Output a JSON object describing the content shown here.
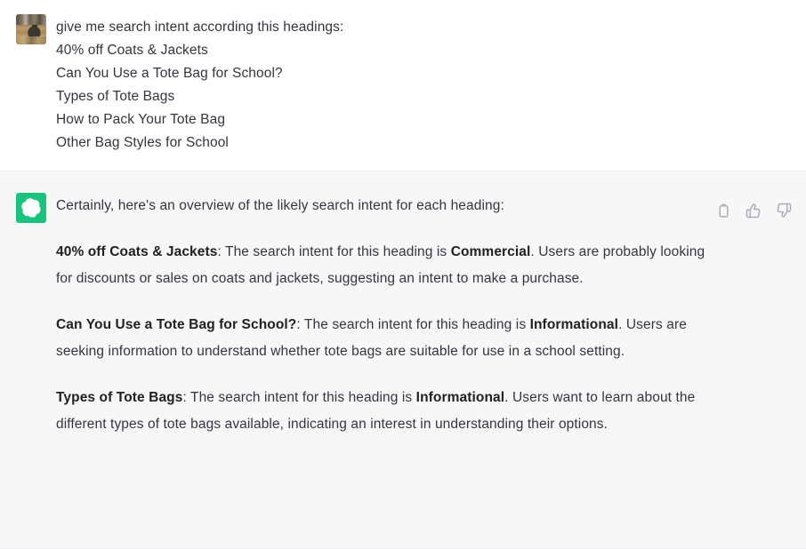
{
  "theme": {
    "user_bg": "#ffffff",
    "assistant_bg": "#f7f7f8",
    "text_color": "#343541",
    "divider": "#ececf1",
    "brand_green": "#19c37d",
    "icon_color": "#acacbe"
  },
  "user_message": {
    "avatar_alt": "user-profile-photo",
    "lines": [
      "give me search intent according this headings:",
      "40% off Coats & Jackets",
      "Can You Use a Tote Bag for School?",
      "Types of Tote Bags",
      "How to Pack Your Tote Bag",
      "Other Bag Styles for School"
    ]
  },
  "assistant_message": {
    "avatar_alt": "openai-logo",
    "intro": "Certainly, here's an overview of the likely search intent for each heading:",
    "paragraphs": [
      {
        "heading": "40% off Coats & Jackets",
        "lead": ": The search intent for this heading is ",
        "intent": "Commercial",
        "tail": ". Users are probably looking for discounts or sales on coats and jackets, suggesting an intent to make a purchase."
      },
      {
        "heading": "Can You Use a Tote Bag for School?",
        "lead": ": The search intent for this heading is ",
        "intent": "Informational",
        "tail": ". Users are seeking information to understand whether tote bags are suitable for use in a school setting."
      },
      {
        "heading": "Types of Tote Bags",
        "lead": ": The search intent for this heading is ",
        "intent": "Informational",
        "tail": ". Users want to learn about the different types of tote bags available, indicating an interest in understanding their options."
      }
    ],
    "actions": [
      {
        "name": "copy-icon",
        "label": "Copy"
      },
      {
        "name": "thumbs-up-icon",
        "label": "Good response"
      },
      {
        "name": "thumbs-down-icon",
        "label": "Bad response"
      }
    ]
  }
}
